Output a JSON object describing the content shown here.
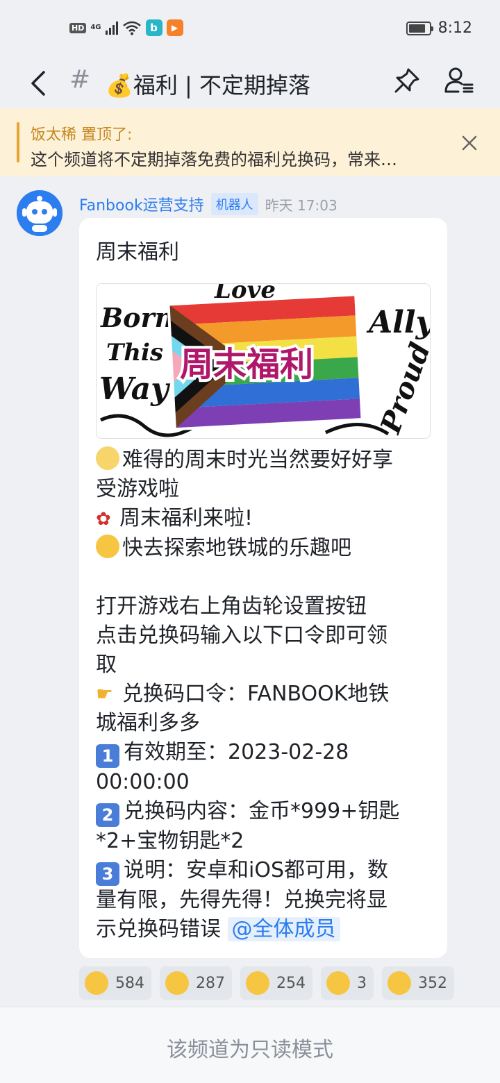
{
  "status_bar": {
    "network_badge": "HD",
    "network_type": "4G",
    "time": "8:12",
    "battery_level": 0.85,
    "apps": [
      {
        "icon": "b-app-icon",
        "letter": "b",
        "color": "#29b6c8"
      },
      {
        "icon": "play-app-icon",
        "letter": "▶",
        "color": "#f5822a"
      }
    ]
  },
  "header": {
    "hash": "#",
    "title": "💰福利 | 不定期掉落"
  },
  "pinned": {
    "author_line": "饭太稀 置顶了:",
    "message": "这个频道将不定期掉落免费的福利兑换码，常来…"
  },
  "message": {
    "sender": "Fanbook运营支持",
    "tag": "机器人",
    "time": "昨天 17:03",
    "title": "周末福利",
    "banner_text": "周末福利",
    "banner_words": [
      "Born",
      "This",
      "Way",
      "Ally",
      "Proud",
      "Love"
    ],
    "lines": {
      "l1": "难得的周末时光当然要好好享",
      "l2": "受游戏啦",
      "l3": "周末福利来啦!",
      "l4": "快去探索地铁城的乐趣吧",
      "l5": "打开游戏右上角齿轮设置按钮",
      "l6": "点击兑换码输入以下口令即可领",
      "l7": "取",
      "l8": "兑换码口令：FANBOOK地铁",
      "l9": "城福利多多",
      "n1": "1",
      "l10": "有效期至：2023-02-28",
      "l11": "00:00:00",
      "n2": "2",
      "l12": "兑换码内容：金币*999+钥匙",
      "l13": "*2+宝物钥匙*2",
      "n3": "3",
      "l14": "说明：安卓和iOS都可用，数",
      "l15": "量有限，先得先得！兑换完将显",
      "l16": "示兑换码错误 ",
      "mention": "@全体成员"
    },
    "icons": [
      "party-emoji-icon",
      "rose-emoji-icon",
      "wink-emoji-icon",
      "pointing-hand-emoji-icon"
    ]
  },
  "reactions": [
    {
      "icon": "blush-face-icon",
      "count": "584"
    },
    {
      "icon": "kiss-face-icon",
      "count": "287"
    },
    {
      "icon": "pleading-face-icon",
      "count": "254"
    },
    {
      "icon": "shush-face-icon",
      "count": "3"
    },
    {
      "icon": "sunglasses-grin-icon",
      "count": "352"
    }
  ],
  "footer": {
    "readonly": "该频道为只读模式"
  }
}
